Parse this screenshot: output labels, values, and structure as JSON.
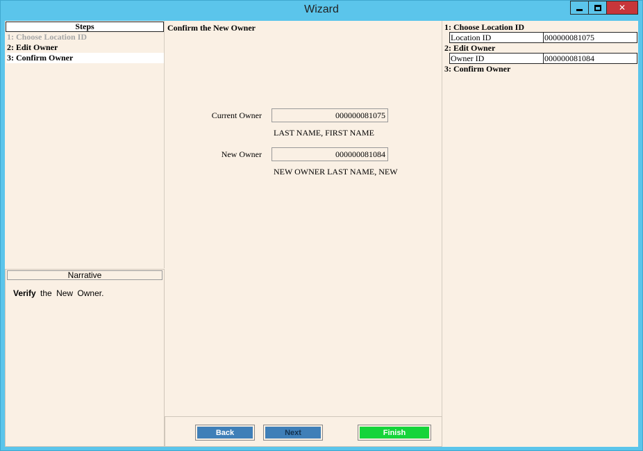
{
  "window": {
    "title": "Wizard",
    "controls": {
      "minimize": "minimize-icon",
      "maximize": "maximize-icon",
      "close": "close-icon",
      "close_glyph": "✕"
    }
  },
  "steps": {
    "header": "Steps",
    "items": [
      {
        "label": "1: Choose Location ID",
        "state": "disabled"
      },
      {
        "label": "2: Edit Owner",
        "state": "normal"
      },
      {
        "label": "3: Confirm Owner",
        "state": "current"
      }
    ]
  },
  "narrative": {
    "header": "Narrative",
    "bold": "Verify",
    "text": "the New Owner."
  },
  "main": {
    "title": "Confirm the New Owner",
    "current_owner": {
      "label": "Current Owner",
      "value": "000000081075",
      "name": "LAST NAME, FIRST NAME"
    },
    "new_owner": {
      "label": "New Owner",
      "value": "000000081084",
      "name": "NEW OWNER LAST NAME, NEW"
    }
  },
  "buttons": {
    "back": "Back",
    "next": "Next",
    "finish": "Finish"
  },
  "summary": {
    "sections": [
      {
        "title": "1: Choose Location ID",
        "key": "Location ID",
        "value": "000000081075"
      },
      {
        "title": "2: Edit Owner",
        "key": "Owner  ID",
        "value": "000000081084"
      },
      {
        "title": "3: Confirm Owner"
      }
    ]
  },
  "colors": {
    "titlebar": "#5bc5eb",
    "background": "#faf0e4",
    "button_blue": "#3f7fb8",
    "finish_green": "#15d43a",
    "close_red": "#c7363a"
  }
}
